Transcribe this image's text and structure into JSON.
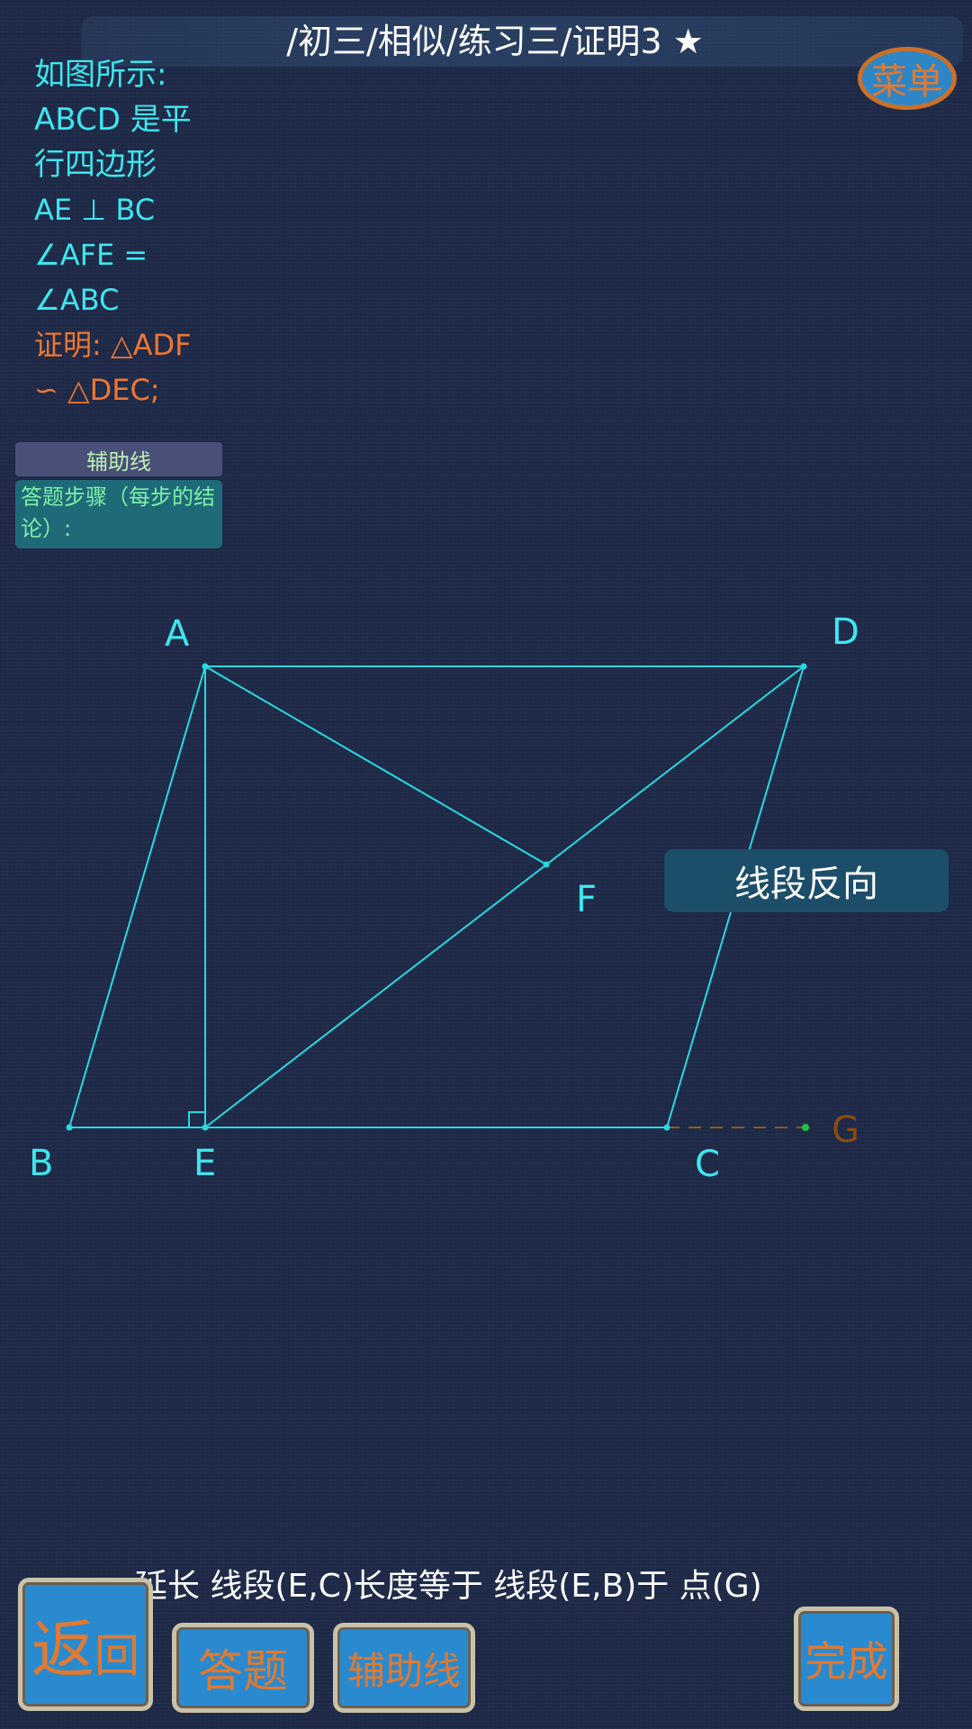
{
  "header": {
    "title": "/初三/相似/练习三/证明3 ★",
    "menu_label": "菜单"
  },
  "problem": {
    "lines": [
      "如图所示:",
      "ABCD 是平",
      "行四边形",
      "AE  ⊥ BC",
      "∠AFE  =",
      "∠ABC"
    ],
    "prove_lines": [
      "证明: △ADF",
      " ∽  △DEC;"
    ]
  },
  "aux_line_label": "辅助线",
  "steps_label": "答题步骤（每步的结论）:",
  "figure": {
    "points": {
      "A": "A",
      "B": "B",
      "C": "C",
      "D": "D",
      "E": "E",
      "F": "F",
      "G": "G"
    },
    "colors": {
      "segments": "#2ad8e0",
      "extension": "#8a5a20",
      "point_g": "#20c040"
    }
  },
  "reverse_segment_label": "线段反向",
  "instruction": "延长 线段(E,C)长度等于 线段(E,B)于 点(G)",
  "buttons": {
    "back_big": "返",
    "back_small": "回",
    "answer": "答题",
    "aux": "辅助线",
    "done": "完成"
  }
}
